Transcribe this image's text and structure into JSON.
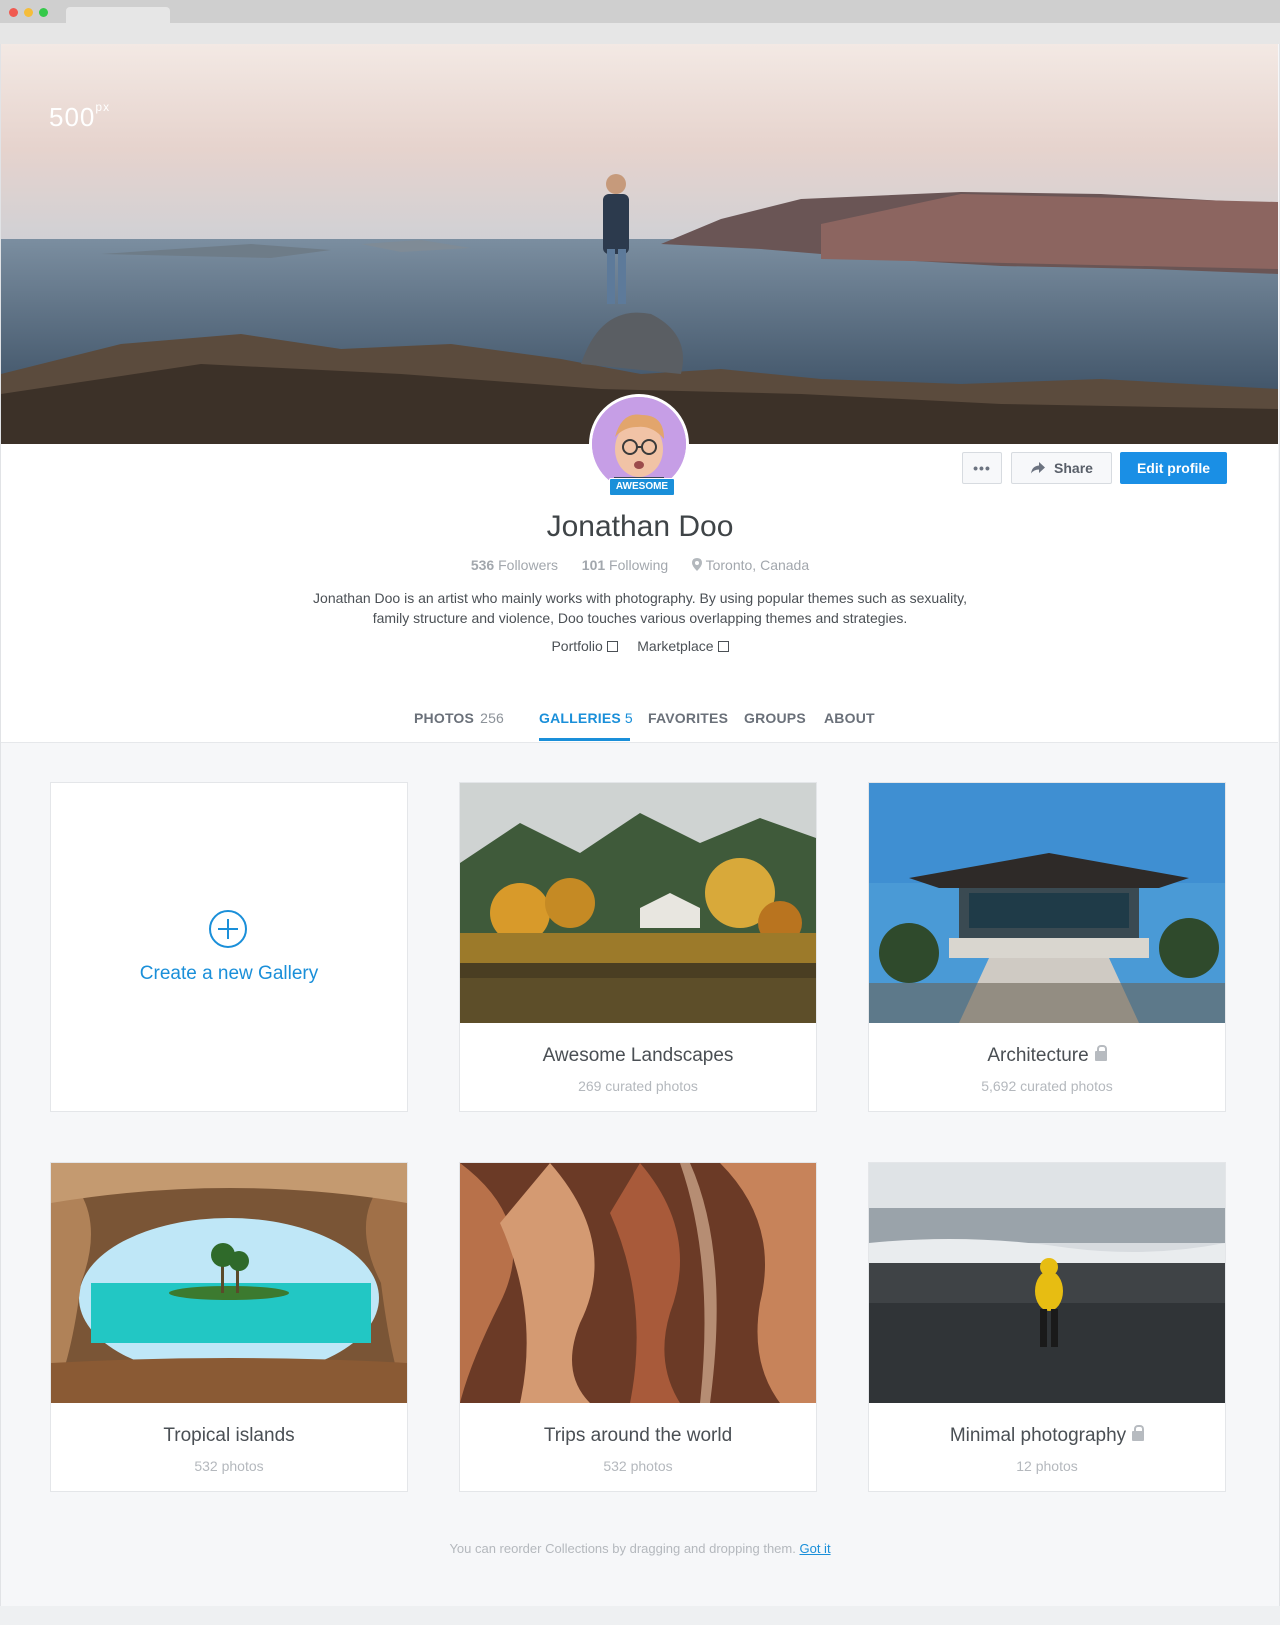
{
  "brand": {
    "logo": "500",
    "logo_sup": "px"
  },
  "profile": {
    "badge": "AWESOME",
    "name": "Jonathan Doo",
    "followers_count": "536",
    "followers_label": "Followers",
    "following_count": "101",
    "following_label": "Following",
    "location": "Toronto, Canada",
    "bio_line1": "Jonathan Doo is an artist who mainly works with photography. By using popular themes such as sexuality,",
    "bio_line2": "family structure and violence, Doo touches various overlapping themes and strategies.",
    "links": [
      "Portfolio",
      "Marketplace"
    ]
  },
  "actions": {
    "more": "•••",
    "share": "Share",
    "edit": "Edit profile"
  },
  "tabs": [
    {
      "label": "PHOTOS",
      "count": "256"
    },
    {
      "label": "GALLERIES",
      "count": "5"
    },
    {
      "label": "FAVORITES",
      "count": ""
    },
    {
      "label": "GROUPS",
      "count": ""
    },
    {
      "label": "ABOUT",
      "count": ""
    }
  ],
  "galleries": {
    "create_label": "Create a new Gallery",
    "items": [
      {
        "title": "Awesome Landscapes",
        "subtitle": "269 curated photos",
        "locked": false
      },
      {
        "title": "Architecture",
        "subtitle": "5,692 curated photos",
        "locked": true
      },
      {
        "title": "Tropical islands",
        "subtitle": "532 photos",
        "locked": false
      },
      {
        "title": "Trips around the world",
        "subtitle": "532 photos",
        "locked": false
      },
      {
        "title": "Minimal photography",
        "subtitle": "12 photos",
        "locked": true
      }
    ]
  },
  "hint": {
    "text": "You can reorder Collections by dragging and dropping them.",
    "link": "Got it"
  },
  "colors": {
    "accent": "#1a8fd9",
    "edit_button": "#1a8fe5"
  }
}
